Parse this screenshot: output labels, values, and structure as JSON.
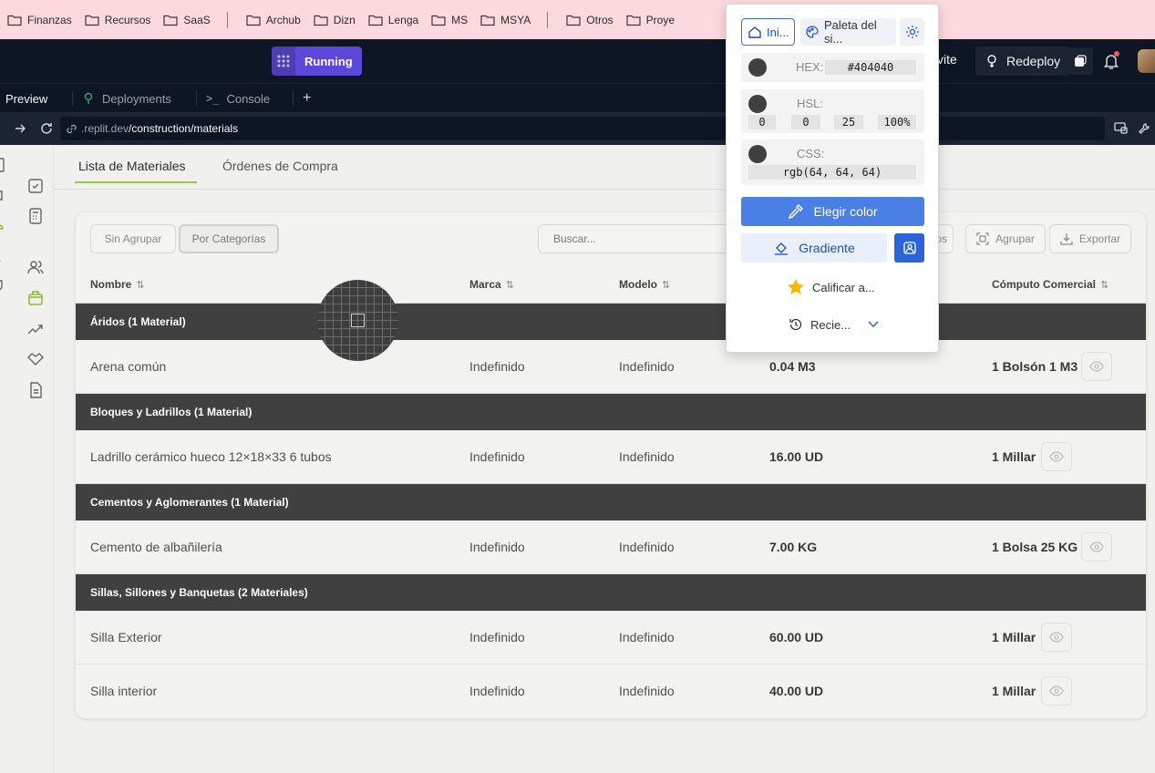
{
  "bookmarks": [
    "Finanzas",
    "Recursos",
    "SaaS",
    "Archub",
    "Dizn",
    "Lenga",
    "MS",
    "MSYA",
    "Otros",
    "Proye"
  ],
  "replit": {
    "run_label": "Running",
    "invite_label": "vite",
    "redeploy_label": "Redeploy",
    "tabs": [
      "Preview",
      "Deployments",
      "Console"
    ],
    "new_tab": "+",
    "url_host": ".replit.dev",
    "url_path": "/construction/materials"
  },
  "content_tabs": [
    "Lista de Materiales",
    "Órdenes de Compra"
  ],
  "toolbar": {
    "group_none": "Sin Agrupar",
    "group_categories": "Por Categorías",
    "search_placeholder": "Buscar...",
    "filters_partial": "ros",
    "group_btn": "Agrupar",
    "export_btn": "Exportar"
  },
  "columns": [
    "Nombre",
    "Marca",
    "Modelo",
    "Cómputo Comercial"
  ],
  "sort_glyph": "⇅",
  "groups": [
    {
      "title": "Áridos (1 Material)",
      "rows": [
        {
          "name": "Arena común",
          "brand": "Indefinido",
          "model": "Indefinido",
          "qty": "0.04 M3",
          "commercial": "1 Bolsón 1 M3"
        }
      ]
    },
    {
      "title": "Bloques y Ladrillos (1 Material)",
      "rows": [
        {
          "name": "Ladrillo cerámico hueco 12×18×33 6 tubos",
          "brand": "Indefinido",
          "model": "Indefinido",
          "qty": "16.00 UD",
          "commercial": "1 Millar"
        }
      ]
    },
    {
      "title": "Cementos y Aglomerantes (1 Material)",
      "rows": [
        {
          "name": "Cemento de albañilería",
          "brand": "Indefinido",
          "model": "Indefinido",
          "qty": "7.00 KG",
          "commercial": "1 Bolsa 25 KG"
        }
      ]
    },
    {
      "title": "Sillas, Sillones y Banquetas (2 Materiales)",
      "rows": [
        {
          "name": "Silla Exterior",
          "brand": "Indefinido",
          "model": "Indefinido",
          "qty": "60.00 UD",
          "commercial": "1 Millar"
        },
        {
          "name": "Silla interior",
          "brand": "Indefinido",
          "model": "Indefinido",
          "qty": "40.00 UD",
          "commercial": "1 Millar"
        }
      ]
    }
  ],
  "picker": {
    "tab_home": "Ini...",
    "tab_palette": "Paleta del si...",
    "swatch_color": "#404040",
    "hex_label": "HEX:",
    "hex_value": "#404040",
    "hsl_label": "HSL:",
    "hsl_values": [
      "0",
      "0",
      "25",
      "100%"
    ],
    "css_label": "CSS:",
    "css_value": "rgb(64, 64, 64)",
    "pick_btn": "Elegir color",
    "gradient_btn": "Gradiente",
    "rate_link": "Calificar a...",
    "recent_link": "Recie..."
  }
}
